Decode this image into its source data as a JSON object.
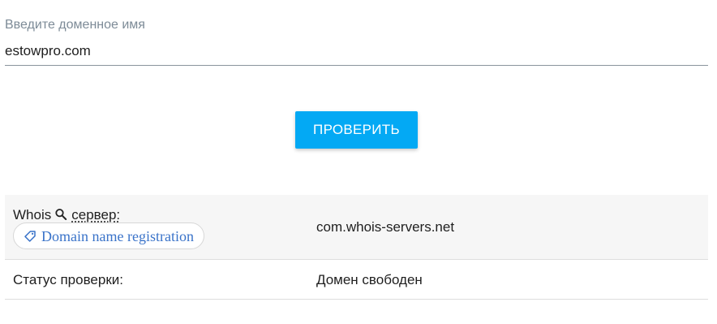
{
  "form": {
    "domain_label": "Введите доменное имя",
    "domain_value": "estowpro.com",
    "check_button_label": "ПРОВЕРИТЬ"
  },
  "results": {
    "whois_label_prefix": "Whois",
    "whois_label_suffix": "сервер:",
    "whois_value": "com.whois-servers.net",
    "chip_label": "Domain name registration",
    "status_label": "Статус проверки:",
    "status_value": "Домен свободен"
  },
  "icons": {
    "search": "search-icon",
    "tag": "tag-icon"
  },
  "colors": {
    "accent": "#03a9f4",
    "label": "#7d8b97",
    "row_background": "#f6f6f6",
    "chip_text": "#3a73c9"
  }
}
